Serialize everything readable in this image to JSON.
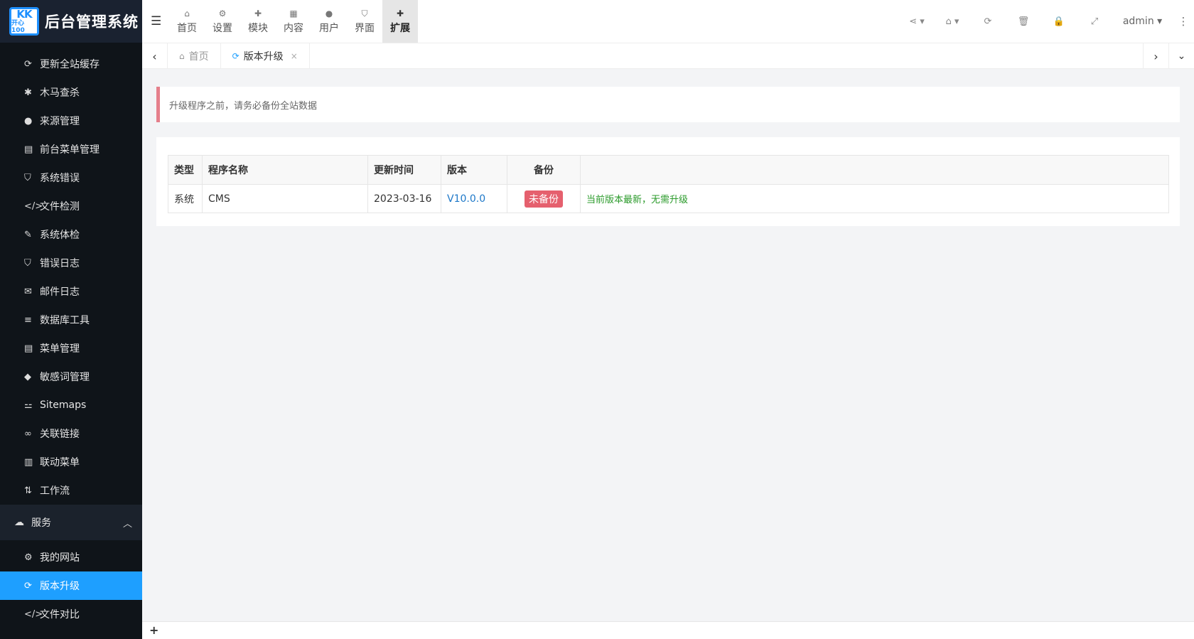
{
  "logo": {
    "mark_top": "KK",
    "mark_bottom": "开心100",
    "title": "后台管理系统"
  },
  "sidebar": {
    "items": [
      {
        "icon": "refresh-icon",
        "glyph": "⟳",
        "label": "更新全站缓存"
      },
      {
        "icon": "bug-icon",
        "glyph": "✱",
        "label": "木马查杀"
      },
      {
        "icon": "globe-icon",
        "glyph": "●",
        "label": "来源管理"
      },
      {
        "icon": "list-icon",
        "glyph": "▤",
        "label": "前台菜单管理"
      },
      {
        "icon": "shield-icon",
        "glyph": "⛉",
        "label": "系统错误"
      },
      {
        "icon": "code-icon",
        "glyph": "</>",
        "label": "文件检测"
      },
      {
        "icon": "wrench-icon",
        "glyph": "✎",
        "label": "系统体检"
      },
      {
        "icon": "shield-icon",
        "glyph": "⛉",
        "label": "错误日志"
      },
      {
        "icon": "envelope-open-icon",
        "glyph": "✉",
        "label": "邮件日志"
      },
      {
        "icon": "database-icon",
        "glyph": "≡",
        "label": "数据库工具"
      },
      {
        "icon": "list-icon",
        "glyph": "▤",
        "label": "菜单管理"
      },
      {
        "icon": "tag-icon",
        "glyph": "◆",
        "label": "敏感词管理"
      },
      {
        "icon": "sitemap-icon",
        "glyph": "⚍",
        "label": "Sitemaps"
      },
      {
        "icon": "link-icon",
        "glyph": "∞",
        "label": "关联链接"
      },
      {
        "icon": "columns-icon",
        "glyph": "▥",
        "label": "联动菜单"
      },
      {
        "icon": "sort-icon",
        "glyph": "⇅",
        "label": "工作流"
      }
    ],
    "group": {
      "icon": "cloud-icon",
      "glyph": "☁",
      "label": "服务"
    },
    "group_items": [
      {
        "icon": "gear-icon",
        "glyph": "⚙",
        "label": "我的网站",
        "active": false
      },
      {
        "icon": "refresh-icon",
        "glyph": "⟳",
        "label": "版本升级",
        "active": true
      },
      {
        "icon": "code-icon",
        "glyph": "</>",
        "label": "文件对比",
        "active": false
      }
    ]
  },
  "topnav": [
    {
      "icon": "home-icon",
      "glyph": "⌂",
      "label": "首页",
      "active": false
    },
    {
      "icon": "gears-icon",
      "glyph": "⚙",
      "label": "设置",
      "active": false
    },
    {
      "icon": "puzzle-icon",
      "glyph": "✚",
      "label": "模块",
      "active": false
    },
    {
      "icon": "grid-icon",
      "glyph": "▦",
      "label": "内容",
      "active": false
    },
    {
      "icon": "user-icon",
      "glyph": "●",
      "label": "用户",
      "active": false
    },
    {
      "icon": "html5-icon",
      "glyph": "⛉",
      "label": "界面",
      "active": false
    },
    {
      "icon": "puzzle-icon",
      "glyph": "✚",
      "label": "扩展",
      "active": true
    }
  ],
  "topright": {
    "share_glyph": "⋖ ▾",
    "home_glyph": "⌂ ▾",
    "refresh_glyph": "⟳",
    "trash_glyph": "🗑",
    "lock_glyph": "🔒",
    "fullscreen_glyph": "⤢",
    "user": "admin ▾",
    "more_glyph": "⋮"
  },
  "tabs": [
    {
      "icon": "home-icon",
      "glyph": "⌂",
      "label": "首页",
      "current": false
    },
    {
      "icon": "refresh-icon",
      "glyph": "⟳",
      "label": "版本升级",
      "current": true,
      "close": "×"
    }
  ],
  "tabbar": {
    "prev": "‹",
    "next": "›",
    "dropdown": "⌄"
  },
  "alert": "升级程序之前，请务必备份全站数据",
  "table": {
    "headers": [
      "类型",
      "程序名称",
      "更新时间",
      "版本",
      "备份",
      ""
    ],
    "rows": [
      {
        "type": "系统",
        "name": "CMS",
        "time": "2023-03-16",
        "version": "V10.0.0",
        "backup": "未备份",
        "message": "当前版本最新，无需升级"
      }
    ]
  },
  "footer": {
    "plus": "+"
  },
  "colors": {
    "active": "#1e9fff",
    "sidebar_bg": "#0f1419",
    "badge": "#e5606e",
    "success": "#2a9a2a",
    "link": "#1e78c8"
  }
}
